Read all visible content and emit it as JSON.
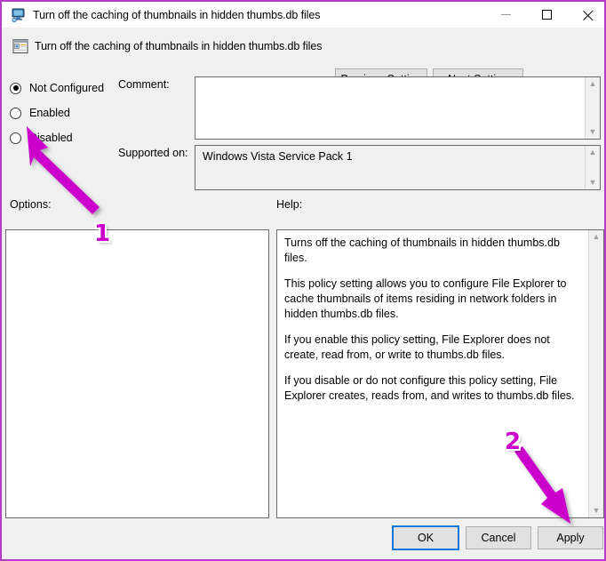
{
  "window": {
    "title": "Turn off the caching of thumbnails in hidden thumbs.db files",
    "icon": "computer-monitor-icon",
    "border_color": "#b43cc8",
    "controls": {
      "minimize": "minimize-icon",
      "maximize": "maximize-icon",
      "close": "close-icon"
    }
  },
  "header": {
    "icon": "group-policy-setting-icon",
    "title": "Turn off the caching of thumbnails in hidden thumbs.db files",
    "previous_button": "Previous Setting",
    "next_button": "Next Setting"
  },
  "state_options": [
    {
      "label": "Not Configured",
      "selected": true
    },
    {
      "label": "Enabled",
      "selected": false
    },
    {
      "label": "Disabled",
      "selected": false
    }
  ],
  "comment": {
    "label": "Comment:",
    "value": "",
    "placeholder": ""
  },
  "supported_on": {
    "label": "Supported on:",
    "value": "Windows Vista Service Pack 1"
  },
  "options": {
    "label": "Options:",
    "content": ""
  },
  "help": {
    "label": "Help:",
    "paragraphs": [
      "Turns off the caching of thumbnails in hidden thumbs.db files.",
      "This policy setting allows you to configure File Explorer to cache thumbnails of items residing in network folders in hidden thumbs.db files.",
      "If you enable this policy setting, File Explorer does not create, read from, or write to thumbs.db files.",
      "If you disable or do not configure this policy setting, File Explorer creates, reads from, and writes to thumbs.db files."
    ]
  },
  "footer": {
    "ok": "OK",
    "cancel": "Cancel",
    "apply": "Apply",
    "focused": "OK",
    "focus_color": "#0078d7"
  },
  "annotations": {
    "color": "#cc00cc",
    "items": [
      {
        "number": "1",
        "points_to": "Disabled radio button"
      },
      {
        "number": "2",
        "points_to": "Apply button"
      }
    ]
  }
}
